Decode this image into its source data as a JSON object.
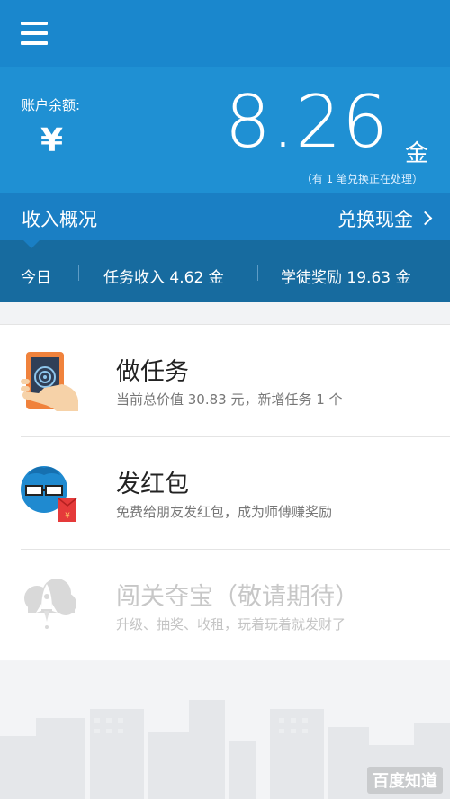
{
  "topbar": {
    "menu_icon": "menu-icon"
  },
  "balance": {
    "label": "账户余额:",
    "currency_symbol": "¥",
    "amount": "8.26",
    "unit": "金",
    "note": "（有 1 笔兑换正在处理）"
  },
  "overview": {
    "title": "收入概况",
    "link": "兑换现金"
  },
  "stats": {
    "today": "今日",
    "task_income": "任务收入 4.62 金",
    "apprentice_reward": "学徒奖励 19.63 金"
  },
  "items": [
    {
      "title": "做任务",
      "desc": "当前总价值 30.83 元，新增任务 1 个",
      "icon": "phone-hand-icon"
    },
    {
      "title": "发红包",
      "desc": "免费给朋友发红包，成为师傅赚奖励",
      "icon": "red-envelope-icon"
    },
    {
      "title": "闯关夺宝（敬请期待）",
      "desc": "升级、抽奖、收租，玩着玩着就发财了",
      "icon": "rocket-icon"
    }
  ],
  "watermark": "百度知道",
  "colors": {
    "topbar": "#1a87cd",
    "balance_bg": "#1f90d3",
    "overview_bg": "#1a7fc4",
    "stats_bg": "#176b9f",
    "phone_orange": "#f0823c",
    "envelope_red": "#e53a3a",
    "icon_blue": "#1f8ad0"
  }
}
